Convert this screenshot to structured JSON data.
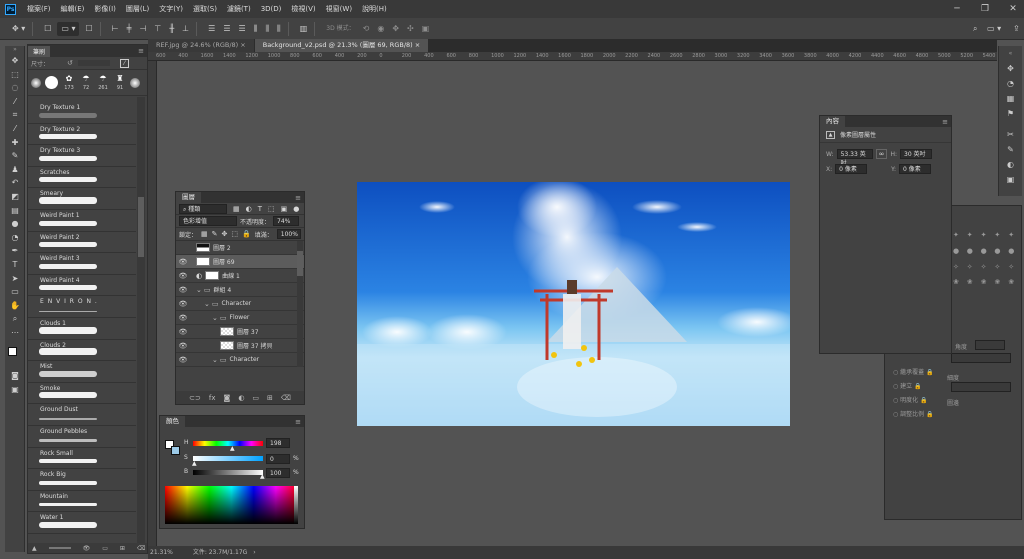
{
  "menubar": {
    "logo": "Ps",
    "items": [
      "檔案(F)",
      "編輯(E)",
      "影像(I)",
      "圖層(L)",
      "文字(Y)",
      "選取(S)",
      "濾鏡(T)",
      "3D(D)",
      "檢視(V)",
      "視窗(W)",
      "說明(H)"
    ],
    "minimize": "─",
    "restore": "❐",
    "close": "✕"
  },
  "options": {
    "mode_3d": "3D 模式："
  },
  "tabs": {
    "tab1": "REF.jpg @ 24.6% (RGB/8)",
    "tab2": "Background_v2.psd @ 21.3% (圖層 69, RGB/8)",
    "close": "×"
  },
  "ruler": {
    "ticks": [
      "600",
      "400",
      "1600",
      "1400",
      "1200",
      "1000",
      "800",
      "600",
      "400",
      "200",
      "0",
      "200",
      "400",
      "600",
      "800",
      "1000",
      "1200",
      "1400",
      "1600",
      "1800",
      "2000",
      "2200",
      "2400",
      "2600",
      "2800",
      "3000",
      "3200",
      "3400",
      "3600",
      "3800",
      "4000",
      "4200",
      "4400",
      "4600",
      "4800",
      "5000",
      "5200",
      "5400"
    ]
  },
  "brushes": {
    "tab": "筆刷",
    "size_label": "尺寸：",
    "presets": [
      "173",
      "72",
      "261",
      "91"
    ],
    "items": [
      "Dry Texture 1",
      "Dry Texture 2",
      "Dry Texture 3",
      "Scratches",
      "Smeary",
      "Weird Paint 1",
      "Weird Paint 2",
      "Weird Paint 3",
      "Weird Paint 4",
      "E N V I R O N .",
      "Clouds 1",
      "Clouds 2",
      "Mist",
      "Smoke",
      "Ground Dust",
      "Ground Pebbles",
      "Rock Small",
      "Rock Big",
      "Mountain",
      "Water 1"
    ]
  },
  "layers": {
    "tab": "圖層",
    "filter_kind": "種類",
    "blend_mode": "色彩增值",
    "opacity_label": "不透明度：",
    "opacity": "74%",
    "lock_label": "鎖定：",
    "fill_label": "填滿：",
    "fill": "100%",
    "rows": [
      {
        "name": "圖層 2"
      },
      {
        "name": "圖層 69"
      },
      {
        "name": "曲線 1"
      },
      {
        "name": "群組 4"
      },
      {
        "name": "Character"
      },
      {
        "name": "Flower"
      },
      {
        "name": "圖層 37"
      },
      {
        "name": "圖層 37 拷貝"
      },
      {
        "name": "Character"
      }
    ]
  },
  "color": {
    "tab": "顏色",
    "h_label": "H",
    "h": "198",
    "s_label": "S",
    "s": "0",
    "s_unit": "%",
    "b_label": "B",
    "b": "100",
    "b_unit": "%"
  },
  "properties": {
    "tab": "內容",
    "title": "像素圖層屬性",
    "w_label": "W:",
    "w": "53.33 英吋",
    "h_label": "H:",
    "h": "30 英吋",
    "x_label": "X:",
    "x": "0 像素",
    "y_label": "Y:",
    "y": "0 像素",
    "link": "∞"
  },
  "bg_panel": {
    "items": [
      "繼承覆蓋",
      "建立",
      "明度化",
      "調整比例"
    ],
    "right_items": [
      "角度",
      "細度",
      "圖邊"
    ]
  },
  "status": {
    "zoom": "21.31%",
    "doc": "文件: 23.7M/1.17G"
  }
}
